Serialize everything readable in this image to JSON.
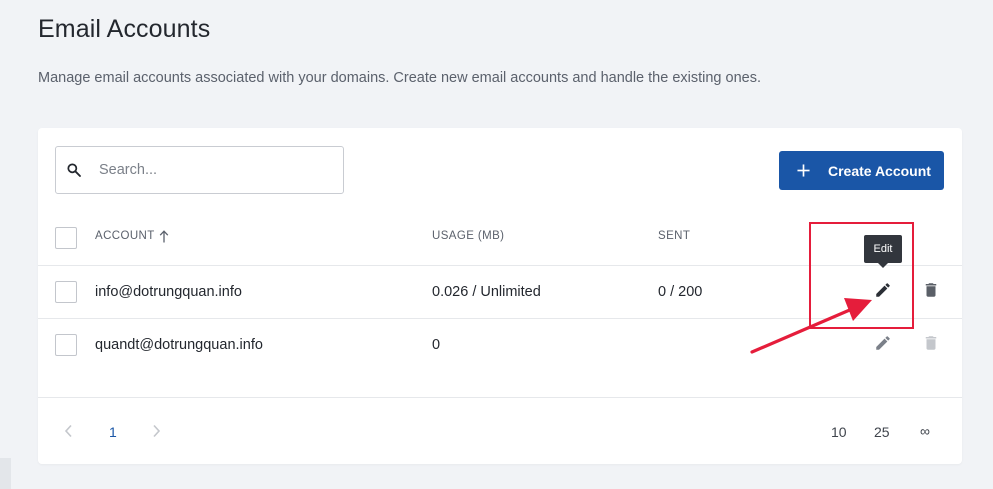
{
  "page": {
    "title": "Email Accounts",
    "subtitle": "Manage email accounts associated with your domains. Create new email accounts and handle the existing ones."
  },
  "toolbar": {
    "search_placeholder": "Search...",
    "search_value": "",
    "create_label": "Create Account"
  },
  "table": {
    "columns": [
      "ACCOUNT",
      "USAGE (MB)",
      "SENT"
    ],
    "sort_column": "ACCOUNT",
    "sort_direction": "ascending",
    "rows": [
      {
        "account": "info@dotrungquan.info",
        "usage": "0.026 / Unlimited",
        "sent": "0 / 200",
        "checked": false
      },
      {
        "account": "quandt@dotrungquan.info",
        "usage": "0",
        "sent": "",
        "checked": false
      }
    ],
    "tooltip": "Edit"
  },
  "pagination": {
    "current_page": "1",
    "page_sizes": [
      "10",
      "25",
      "∞"
    ]
  },
  "colors": {
    "primary": "#1a56a7",
    "annotation": "#e51d3b",
    "background": "#f1f3f6"
  },
  "icons": [
    "search-icon",
    "plus-icon",
    "sort-arrow-up-icon",
    "pencil-icon",
    "trash-icon",
    "chevron-left-icon",
    "chevron-right-icon"
  ]
}
